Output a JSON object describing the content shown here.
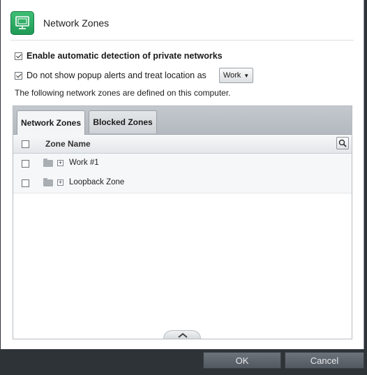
{
  "dialog": {
    "title": "Network Zones",
    "app_icon": "network-monitor-icon"
  },
  "options": {
    "auto_detect_label": "Enable automatic detection of private networks",
    "auto_detect_checked": true,
    "no_popup_label": "Do not show popup alerts and treat location as",
    "no_popup_checked": true,
    "location_value": "Work"
  },
  "description": "The following network zones are defined on this computer.",
  "tabs": [
    {
      "label": "Network Zones",
      "active": true
    },
    {
      "label": "Blocked Zones",
      "active": false
    }
  ],
  "table": {
    "column_header": "Zone Name",
    "rows": [
      {
        "name": "Work #1"
      },
      {
        "name": "Loopback Zone"
      }
    ]
  },
  "buttons": {
    "ok": "OK",
    "cancel": "Cancel"
  },
  "colors": {
    "accent_green": "#2aa963",
    "footer_bg": "#2e3338"
  }
}
